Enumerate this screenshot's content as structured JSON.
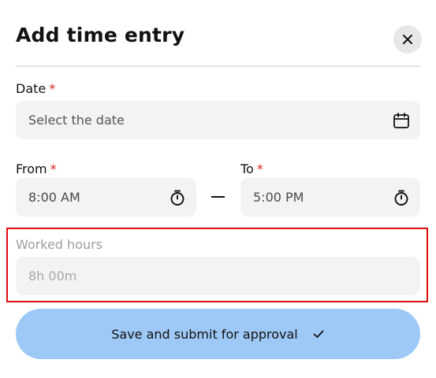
{
  "dialog": {
    "title": "Add time entry",
    "close_icon": "close-icon"
  },
  "date": {
    "label": "Date",
    "required_mark": "*",
    "placeholder": "Select the date",
    "icon": "calendar-icon"
  },
  "from": {
    "label": "From",
    "required_mark": "*",
    "value": "8:00 AM",
    "icon": "stopwatch-icon"
  },
  "to": {
    "label": "To",
    "required_mark": "*",
    "value": "5:00 PM",
    "icon": "stopwatch-icon"
  },
  "worked_hours": {
    "label": "Worked hours",
    "value": "8h 00m"
  },
  "submit": {
    "label": "Save and submit for approval",
    "icon": "check-icon",
    "color": "#9ec9f7"
  },
  "colors": {
    "required": "#d61f1f",
    "highlight": "#e00d0d",
    "field_bg": "#f3f3f3"
  }
}
